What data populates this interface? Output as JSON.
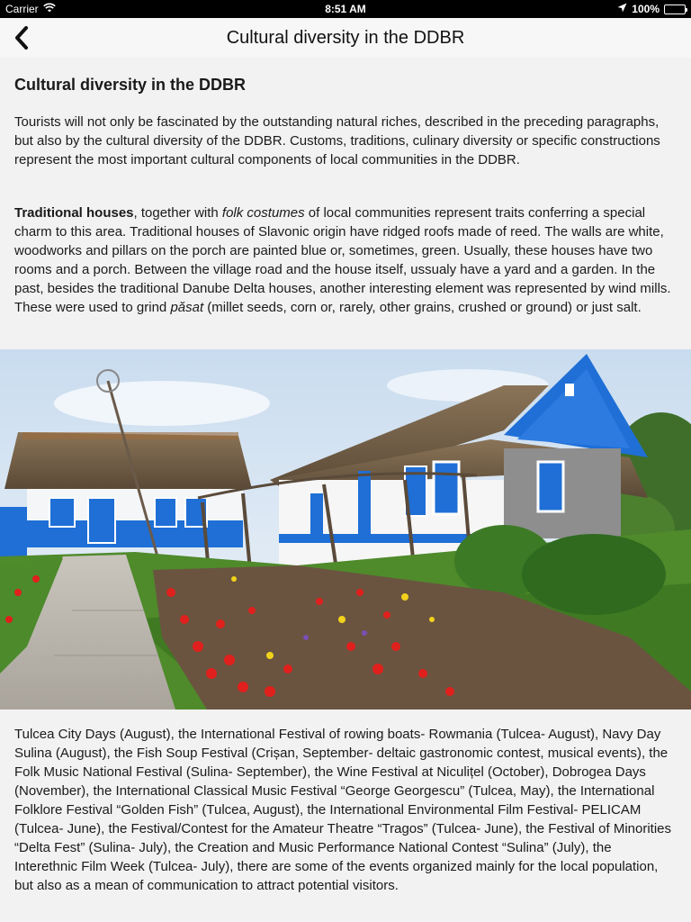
{
  "status_bar": {
    "carrier": "Carrier",
    "time": "8:51 AM",
    "battery": "100%",
    "battery_level": 1.0
  },
  "nav": {
    "title": "Cultural diversity in the DDBR",
    "back_icon": "chevron-left-icon"
  },
  "article": {
    "heading": "Cultural diversity in the DDBR",
    "paragraph1": "Tourists will not only be fascinated by the outstanding natural riches, described in the preceding paragraphs, but also by the cultural diversity of the DDBR. Customs, traditions, culinary diversity or specific constructions represent the most important cultural components of local communities in the DDBR.",
    "paragraph2": {
      "bold_lead": "Traditional houses",
      "text_a": ", together with ",
      "italic_a": "folk costumes",
      "text_b": " of local communities represent traits conferring a special charm to this area. Traditional houses of Slavonic origin have ridged roofs made of reed. The walls are white, woodworks and pillars on the porch are painted blue or, sometimes, green. Usually, these houses have two rooms and a porch. Between the village road and the house itself, ussualy have a yard and a garden. In the past, besides the traditional Danube Delta houses, another interesting element was represented by wind mills. These were used to grind ",
      "italic_b": "păsat",
      "text_c": " (millet seeds, corn or, rarely, other grains, crushed or ground) or just salt."
    },
    "paragraph3": "Tulcea City Days (August), the International Festival of rowing boats- Rowmania (Tulcea- August), Navy Day Sulina (August), the Fish Soup Festival (Crișan, September- deltaic gastronomic contest, musical events), the Folk Music National Festival (Sulina- September), the Wine Festival at Niculițel (October), Dobrogea Days (November), the International Classical Music Festival “George Georgescu” (Tulcea, May), the International Folklore Festival “Golden Fish” (Tulcea, August), the International Environmental Film Festival- PELICAM (Tulcea- June), the Festival/Contest for the Amateur Theatre “Tragos” (Tulcea- June), the Festival of Minorities “Delta Fest” (Sulina- July), the Creation and Music Performance National Contest “Sulina” (July), the Interethnic Film Week (Tulcea- July), there are some of the events organized mainly for the local population, but also as a mean of communication to attract potential visitors."
  },
  "colors": {
    "house_blue": "#1f6fd6",
    "sky": "#dbe8f5",
    "grass": "#4f8a2b",
    "tulip_red": "#e0201c"
  }
}
